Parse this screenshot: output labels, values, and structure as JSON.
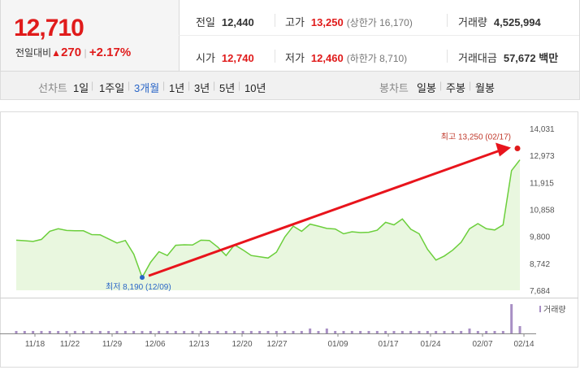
{
  "quote": {
    "price": "12,710",
    "change_label": "전일대비",
    "change_arrow": "▲",
    "change_value": "270",
    "change_pct": "+2.17%",
    "prev_label": "전일",
    "prev_value": "12,440",
    "high_label": "고가",
    "high_value": "13,250",
    "high_sub": "(상한가 16,170)",
    "volume_label": "거래량",
    "volume_value": "4,525,994",
    "open_label": "시가",
    "open_value": "12,740",
    "low_label": "저가",
    "low_value": "12,460",
    "low_sub": "(하한가 8,710)",
    "amount_label": "거래대금",
    "amount_value": "57,672",
    "amount_unit": "백만"
  },
  "period_bar": {
    "line_label": "선차트",
    "line_options": [
      "1일",
      "1주일",
      "3개월",
      "1년",
      "3년",
      "5년",
      "10년"
    ],
    "selected_line": "3개월",
    "candle_label": "봉차트",
    "candle_options": [
      "일봉",
      "주봉",
      "월봉"
    ]
  },
  "colors": {
    "up": "#e01b1b",
    "line": "#6ccf3c",
    "area": "#e9f7df",
    "low_marker": "#2a66c7",
    "volume_bar": "#a88fc4",
    "arrow": "#e8141c"
  },
  "chart_data": [
    {
      "type": "area",
      "y_ticks": [
        "14,031",
        "12,973",
        "11,915",
        "10,858",
        "9,800",
        "8,742",
        "7,684"
      ],
      "ylim": [
        7684,
        14031
      ],
      "grid": false,
      "x_ticks": [
        "11/18",
        "11/22",
        "11/29",
        "12/06",
        "12/13",
        "12/20",
        "12/27",
        "01/09",
        "01/17",
        "01/24",
        "02/07",
        "02/14"
      ],
      "values": [
        9650,
        9630,
        9600,
        9680,
        10000,
        10100,
        10030,
        10020,
        10020,
        9870,
        9860,
        9700,
        9540,
        9640,
        9100,
        8190,
        8780,
        9200,
        9050,
        9450,
        9470,
        9460,
        9650,
        9640,
        9380,
        9050,
        9470,
        9270,
        9050,
        9000,
        8950,
        9180,
        9780,
        10200,
        10000,
        10280,
        10200,
        10110,
        10090,
        9900,
        9980,
        9950,
        9960,
        10040,
        10350,
        10250,
        10480,
        10080,
        9900,
        9290,
        8870,
        9030,
        9260,
        9570,
        10100,
        10300,
        10100,
        10050,
        10250,
        12380,
        12800
      ],
      "annotations": {
        "high": {
          "text": "최고 13,250 (02/17)",
          "value": 13250
        },
        "low": {
          "text": "최저 8,190 (12/09)",
          "value": 8190
        }
      }
    },
    {
      "type": "bar",
      "legend": "거래량",
      "values": [
        1,
        1,
        1,
        1,
        1,
        1,
        1,
        1,
        1,
        1,
        1,
        1,
        1,
        1,
        1,
        1,
        1,
        1,
        1,
        1,
        1,
        1,
        1,
        1,
        1,
        1,
        1,
        1,
        1,
        1,
        1,
        1,
        1,
        1,
        1,
        2,
        1,
        2,
        1,
        1,
        1,
        1,
        1,
        1,
        1,
        1,
        1,
        1,
        1,
        1,
        1,
        1,
        1,
        1,
        2,
        1,
        1,
        1,
        1,
        12,
        3
      ]
    }
  ]
}
